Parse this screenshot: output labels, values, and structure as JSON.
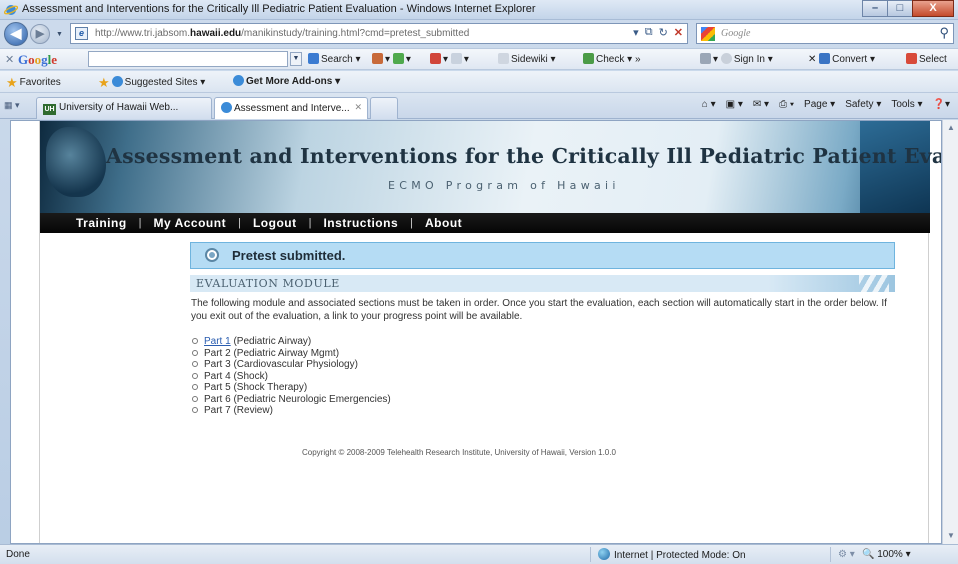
{
  "window": {
    "title": "Assessment and Interventions for the Critically Ill Pediatric Patient Evaluation - Windows Internet Explorer",
    "minimize": "–",
    "maximize": "□",
    "close": "X"
  },
  "address": {
    "url_prefix": "http://www.tri.jabsom.",
    "url_domain": "hawaii.edu",
    "url_suffix": "/manikinstudy/training.html?cmd=pretest_submitted",
    "search_placeholder": "Google"
  },
  "google_toolbar": {
    "logo": [
      "G",
      "o",
      "o",
      "g",
      "l",
      "e"
    ],
    "search_label": "Search",
    "sidewiki_label": "Sidewiki",
    "check_label": "Check",
    "more": "»",
    "signin_label": "Sign In",
    "convert_label": "Convert",
    "select_label": "Select"
  },
  "favorites_bar": {
    "favorites_label": "Favorites",
    "suggested_label": "Suggested Sites ▾",
    "addons_label": "Get More Add-ons ▾"
  },
  "tabs": [
    {
      "label": "University of Hawaii Web...",
      "icon": "uh-icon",
      "badge": "UH"
    },
    {
      "label": "Assessment and Interve...",
      "icon": "ie-icon"
    }
  ],
  "command_bar": {
    "page_label": "Page ▾",
    "safety_label": "Safety ▾",
    "tools_label": "Tools ▾"
  },
  "site": {
    "title": "Assessment and Interventions for the Critically Ill Pediatric Patient Evaluation",
    "subtitle": "ECMO Program of Hawaii",
    "nav": [
      "Training",
      "My Account",
      "Logout",
      "Instructions",
      "About"
    ],
    "nav_separator": "|",
    "notice": "Pretest submitted.",
    "module_heading": "EVALUATION MODULE",
    "intro": "The following module and associated sections must be taken in order. Once you start the evaluation, each section will automatically start in the order below. If you exit out of the evaluation, a link to your progress point will be available.",
    "parts": [
      {
        "link": "Part 1",
        "text": " (Pediatric Airway)"
      },
      {
        "link": "",
        "text": "Part 2 (Pediatric Airway Mgmt)"
      },
      {
        "link": "",
        "text": "Part 3 (Cardiovascular Physiology)"
      },
      {
        "link": "",
        "text": "Part 4 (Shock)"
      },
      {
        "link": "",
        "text": "Part 5 (Shock Therapy)"
      },
      {
        "link": "",
        "text": "Part 6 (Pediatric Neurologic Emergencies)"
      },
      {
        "link": "",
        "text": "Part 7 (Review)"
      }
    ],
    "copyright": "Copyright © 2008-2009 Telehealth Research Institute, University of Hawaii, Version 1.0.0"
  },
  "status_bar": {
    "status": "Done",
    "zone": "Internet | Protected Mode: On",
    "zoom": "100%"
  }
}
